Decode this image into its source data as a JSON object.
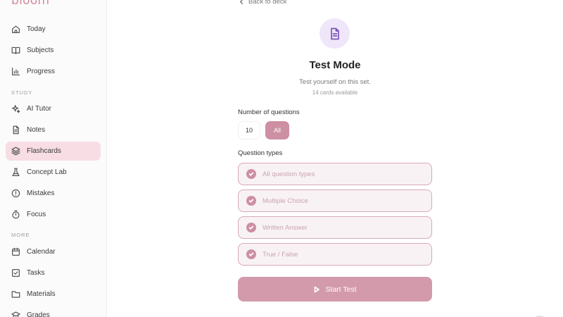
{
  "app": {
    "logo": "bloom"
  },
  "sidebar": {
    "top_items": [
      {
        "label": "Today",
        "icon": "home-icon"
      },
      {
        "label": "Subjects",
        "icon": "book-icon"
      },
      {
        "label": "Progress",
        "icon": "bar-chart-icon"
      }
    ],
    "study_label": "STUDY",
    "study_items": [
      {
        "label": "AI Tutor",
        "icon": "sparkle-icon"
      },
      {
        "label": "Notes",
        "icon": "note-icon"
      },
      {
        "label": "Flashcards",
        "icon": "layers-icon",
        "active": true
      },
      {
        "label": "Concept Lab",
        "icon": "flask-icon"
      },
      {
        "label": "Mistakes",
        "icon": "alert-icon"
      },
      {
        "label": "Focus",
        "icon": "timer-icon"
      }
    ],
    "more_label": "MORE",
    "more_items": [
      {
        "label": "Calendar",
        "icon": "calendar-icon"
      },
      {
        "label": "Tasks",
        "icon": "checkbox-icon"
      },
      {
        "label": "Materials",
        "icon": "folder-icon"
      },
      {
        "label": "Grades",
        "icon": "grad-cap-icon"
      }
    ]
  },
  "main": {
    "back_label": "Back to deck",
    "title": "Test Mode",
    "subtitle": "Test yourself on this set.",
    "cards_available": "14 cards available",
    "num_questions_label": "Number of questions",
    "num_value": "10",
    "all_label": "All",
    "question_types_label": "Question types",
    "question_types": [
      "All question types",
      "Multiple Choice",
      "Written Answer",
      "True / False"
    ],
    "start_label": "Start Test"
  },
  "colors": {
    "accent": "#cd8fa2",
    "active_bg": "#f8dde5",
    "badge_bg": "#efe6fa",
    "badge_icon": "#7c55b8"
  }
}
